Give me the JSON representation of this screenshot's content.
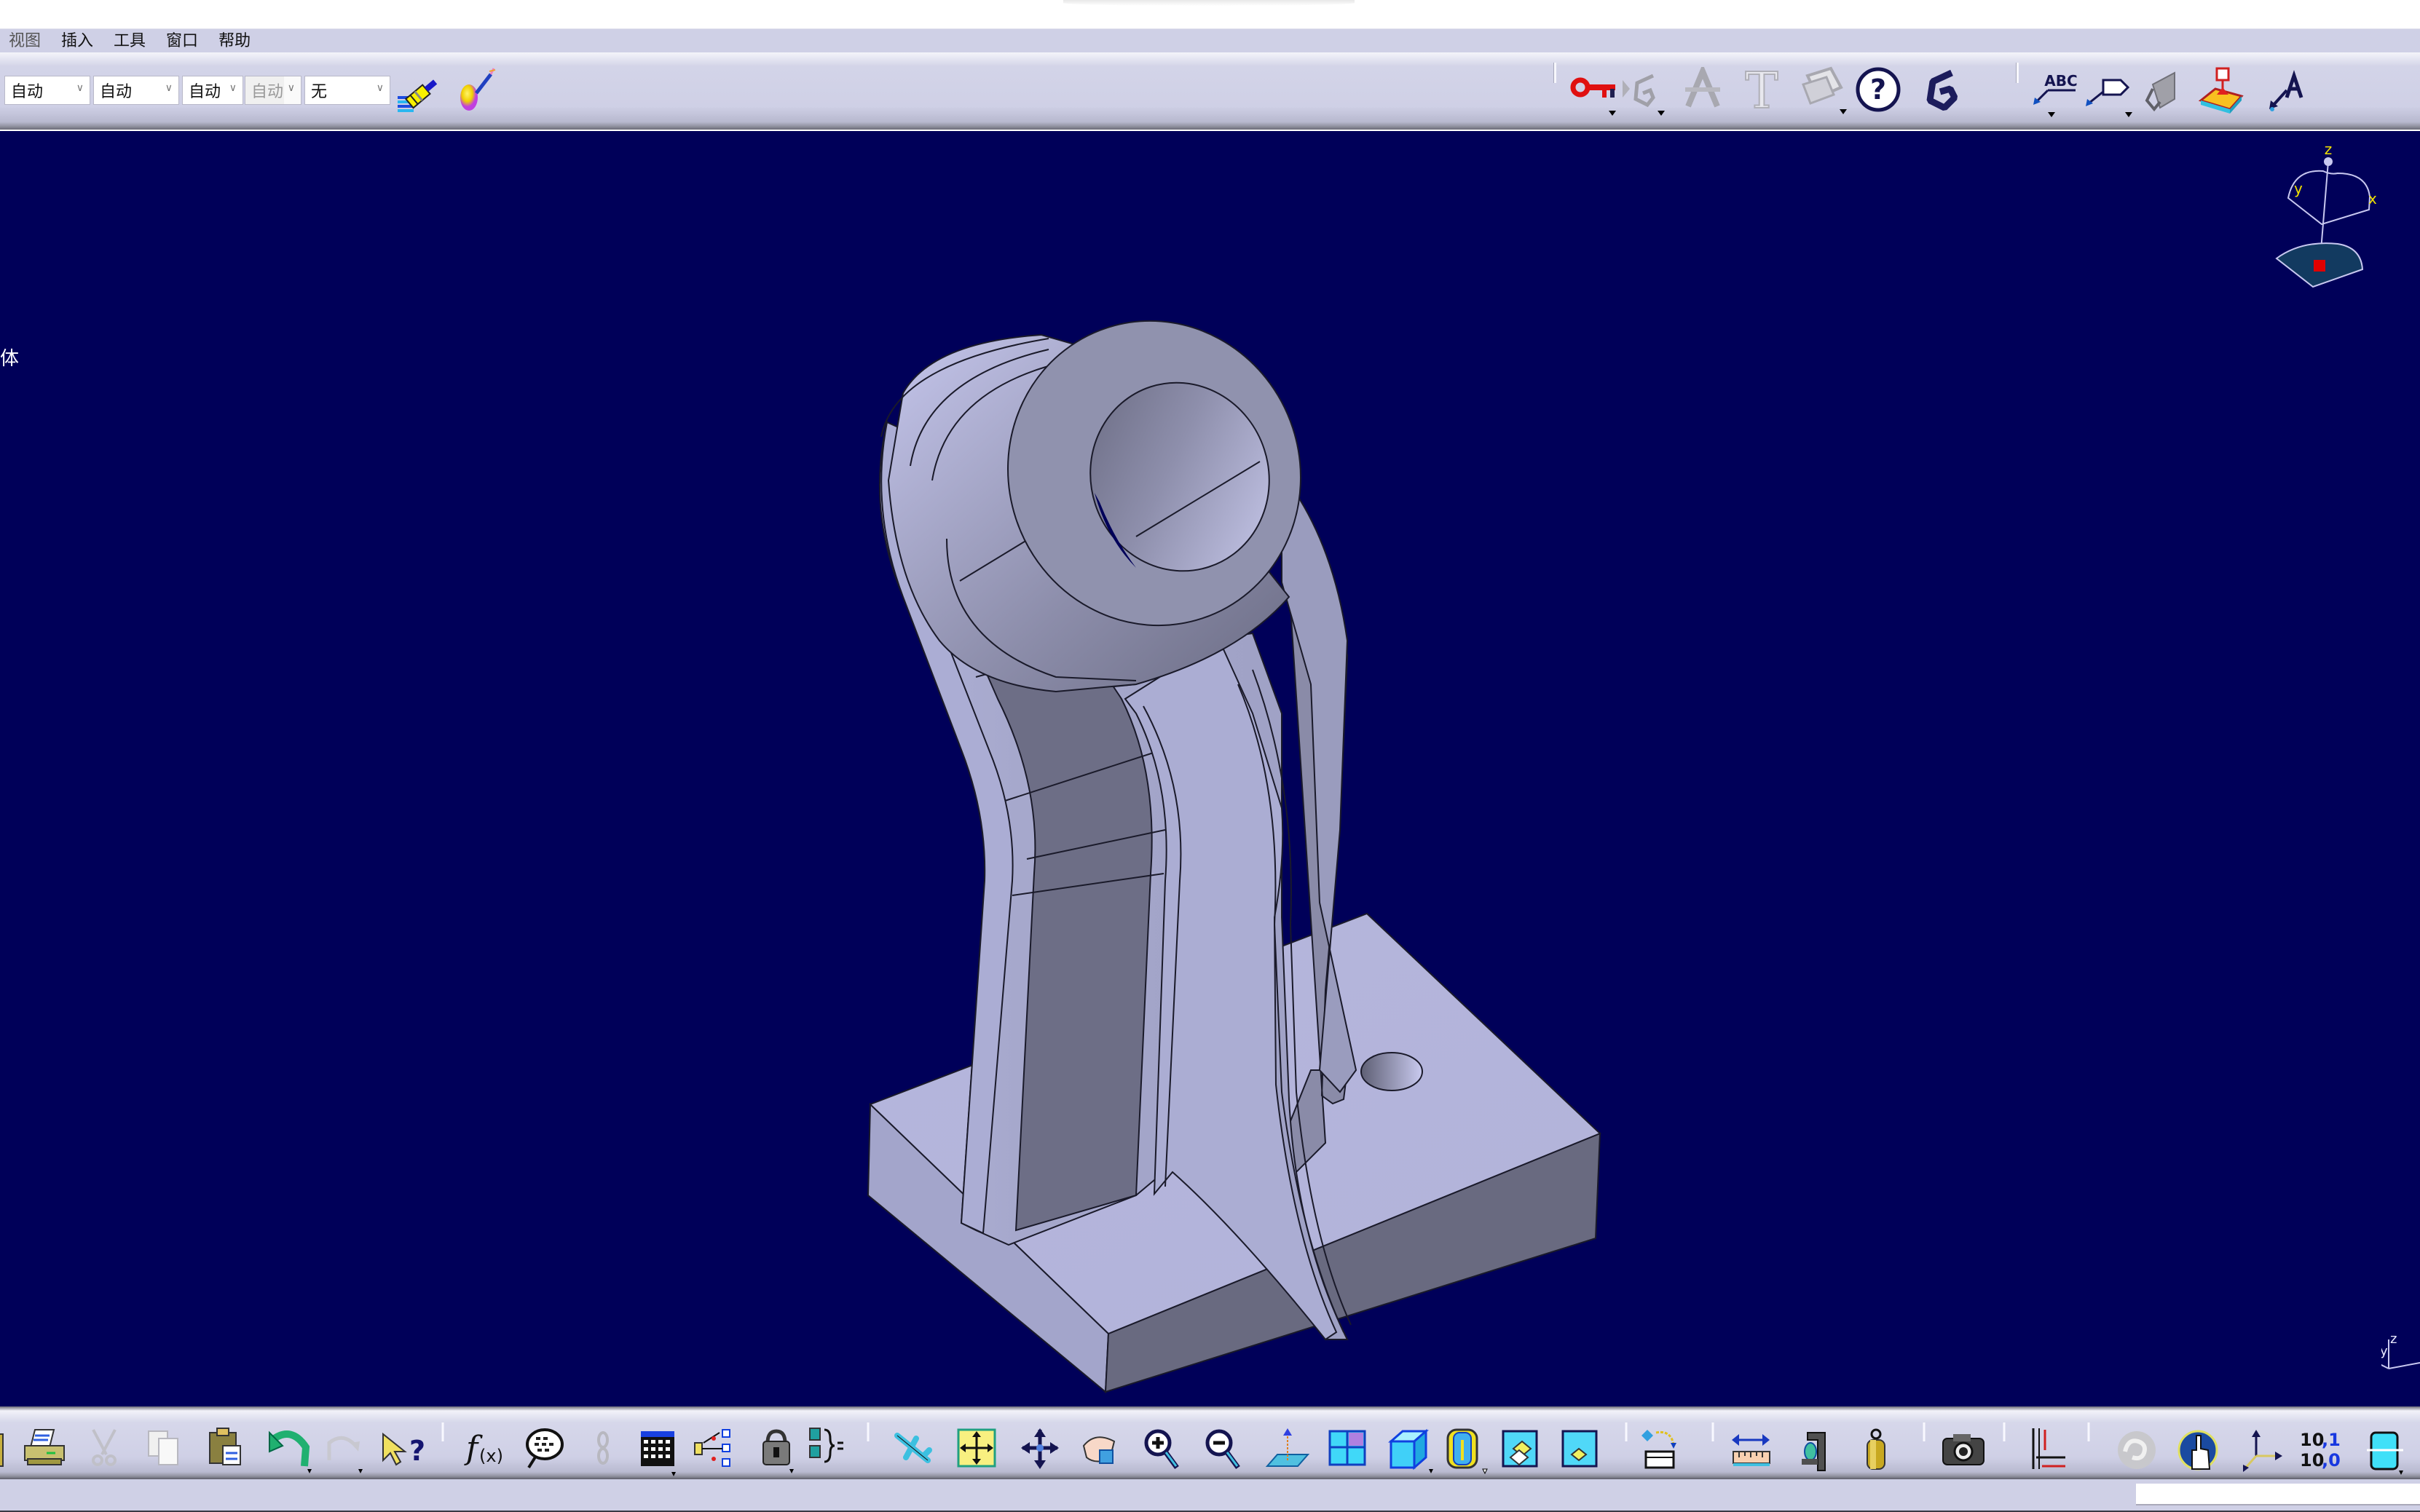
{
  "menubar": {
    "items": [
      "视图",
      "插入",
      "工具",
      "窗口",
      "帮助"
    ]
  },
  "properties_toolbar": {
    "combos": [
      {
        "name": "color-combo",
        "value": "自动",
        "enabled": true
      },
      {
        "name": "transparency-combo",
        "value": "自动",
        "enabled": true
      },
      {
        "name": "line-thickness-combo",
        "value": "自动",
        "enabled": true
      },
      {
        "name": "line-type-combo",
        "value": "自动",
        "enabled": false
      },
      {
        "name": "layer-combo",
        "value": "无",
        "enabled": true
      }
    ],
    "icons": [
      "painter-icon",
      "apply-material-icon"
    ]
  },
  "annotation_toolbar": {
    "icons": [
      "key-lock-icon",
      "geometry-link-icon",
      "pitch-icon",
      "text-icon",
      "sketch-plane-icon",
      "help-icon",
      "catia-g-icon"
    ]
  },
  "annotation_toolbar_2": {
    "icons": [
      "text-with-leader-icon",
      "flag-note-icon",
      "roughness-icon",
      "datum-feature-icon",
      "datum-target-icon"
    ]
  },
  "viewport": {
    "background": "#000059",
    "part_color": "#b3b5da",
    "side_label": "体",
    "compass": {
      "axes": [
        "x",
        "y",
        "z"
      ],
      "label_color": "#f0e000"
    },
    "mini_axis": {
      "axes": [
        "y",
        "z"
      ]
    }
  },
  "bottom_toolbar": {
    "groups": [
      [
        "save-icon",
        "print-icon",
        "cut-icon",
        "copy-icon",
        "paste-icon",
        "undo-icon",
        "redo-icon",
        "whats-this-icon"
      ],
      [
        "formula-icon",
        "knowledge-advisor-icon",
        "link-icon",
        "table-icon",
        "design-table-icon",
        "lock-icon",
        "parameters-icon"
      ],
      [
        "fly-mode-icon",
        "fit-all-icon",
        "pan-icon",
        "rotate-icon",
        "zoom-in-icon",
        "zoom-out-icon",
        "normal-view-icon",
        "multi-view-icon",
        "iso-view-icon",
        "view-mode-icon",
        "hide-show-icon",
        "swap-space-icon"
      ],
      [
        "scan-icon"
      ],
      [
        "measure-between-icon",
        "measure-item-icon",
        "measure-inertia-icon"
      ],
      [
        "capture-icon"
      ],
      [
        "constraints-icon"
      ],
      [
        "catalog-icon",
        "touch-icon",
        "axis-system-icon",
        "units-icon",
        "apply-dress-up-icon"
      ]
    ]
  },
  "statusbar": {
    "message": "",
    "command_input": ""
  }
}
